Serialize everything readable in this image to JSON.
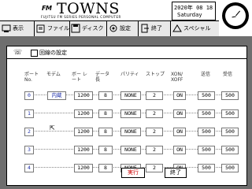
{
  "header": {
    "logo_small": "FM",
    "logo_big": "TOWNS",
    "logo_subtitle": "FUJITSU FM SERIES PERSONAL COMPUTER",
    "date": "2020年 08 18",
    "weekday": "Saturday"
  },
  "toolbar": {
    "items": [
      {
        "label": "表示",
        "icon": "display-icon"
      },
      {
        "label": "ファイル",
        "icon": "file-icon"
      },
      {
        "label": "ディスク",
        "icon": "disk-icon"
      },
      {
        "label": "設定",
        "icon": "settings-icon"
      },
      {
        "label": "終了",
        "icon": "exit-icon"
      },
      {
        "label": "スペシャル",
        "icon": "special-icon"
      }
    ]
  },
  "dialog": {
    "title": "回線の設定",
    "columns": [
      "ポート No.",
      "モデム",
      "ボー レート",
      "データ 長",
      "パリティ",
      "ストップ",
      "XON/ XOFF",
      "送信",
      "受信"
    ],
    "rows": [
      {
        "port": "0",
        "modem": "内蔵",
        "baud": "1200",
        "data": "8",
        "parity": "NONE",
        "stop": "2",
        "xon": "ON",
        "send": "500",
        "recv": "500"
      },
      {
        "port": "1",
        "modem": "",
        "baud": "1200",
        "data": "8",
        "parity": "NONE",
        "stop": "2",
        "xon": "ON",
        "send": "500",
        "recv": "500"
      },
      {
        "port": "2",
        "modem": "",
        "baud": "1200",
        "data": "8",
        "parity": "NONE",
        "stop": "2",
        "xon": "ON",
        "send": "500",
        "recv": "500"
      },
      {
        "port": "3",
        "modem": "",
        "baud": "1200",
        "data": "8",
        "parity": "NONE",
        "stop": "2",
        "xon": "ON",
        "send": "500",
        "recv": "500"
      },
      {
        "port": "4",
        "modem": "",
        "baud": "1200",
        "data": "8",
        "parity": "NONE",
        "stop": "2",
        "xon": "ON",
        "send": "500",
        "recv": "500"
      }
    ],
    "buttons": {
      "run": "実行",
      "exit": "終了"
    }
  },
  "colors": {
    "desktop": "#6e6e6e",
    "accent_blue": "#2233aa",
    "run_red": "#cc0000"
  }
}
